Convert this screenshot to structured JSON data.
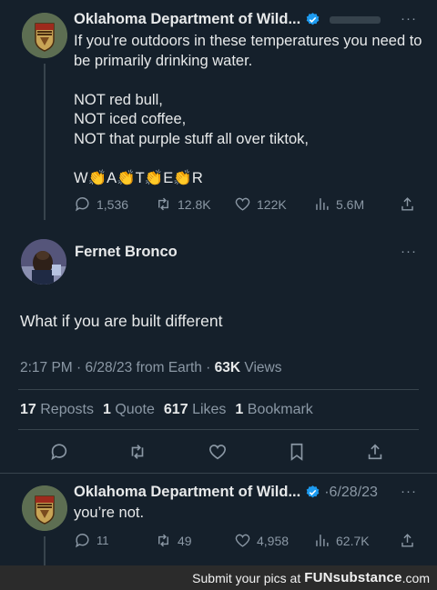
{
  "tweets": [
    {
      "author": "Oklahoma Department of Wild...",
      "handle": "",
      "text": "If you’re outdoors in these temperatures you need to be primarily drinking water.\n\nNOT red bull,\nNOT iced coffee,\nNOT that purple stuff all over tiktok,\n\nW👏A👏T👏E👏R",
      "counts": {
        "replies": "1,536",
        "reposts": "12.8K",
        "likes": "122K",
        "views": "5.6M"
      }
    },
    {
      "author": "Fernet Bronco",
      "text": "What if you are built different",
      "time": "2:17 PM · 6/28/23 from Earth · ",
      "views_count": "63K",
      "views_label": " Views",
      "stats": [
        {
          "value": "17",
          "label": "Reposts"
        },
        {
          "value": "1",
          "label": "Quote"
        },
        {
          "value": "617",
          "label": "Likes"
        },
        {
          "value": "1",
          "label": "Bookmark"
        }
      ]
    },
    {
      "author": "Oklahoma Department of Wild...",
      "handle": "·6/28/23",
      "text": "you’re not.",
      "counts": {
        "replies": "11",
        "reposts": "49",
        "likes": "4,958",
        "views": "62.7K"
      }
    }
  ],
  "more_icon": "···",
  "footer": {
    "text": "Submit your pics at",
    "brand": "FUNsubstance",
    "suffix": ".com"
  },
  "colors": {
    "background": "#15202b",
    "muted": "#8b98a5",
    "accent": "#1d9bf0"
  }
}
